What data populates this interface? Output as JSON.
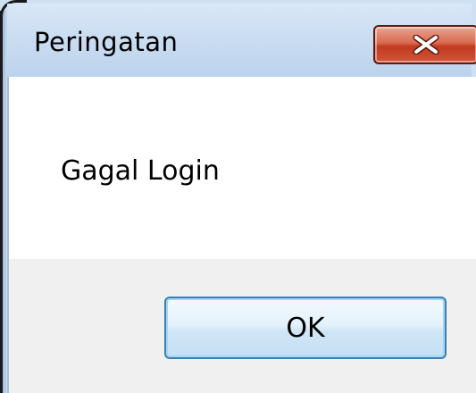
{
  "dialog": {
    "title": "Peringatan",
    "message": "Gagal Login",
    "ok_label": "OK",
    "close_icon": "close-icon"
  },
  "colors": {
    "close_button": "#c23a20",
    "ok_border": "#3c7fb1",
    "footer_bg": "#f0f0f0",
    "titlebar_bg": "#c8dbf1"
  }
}
